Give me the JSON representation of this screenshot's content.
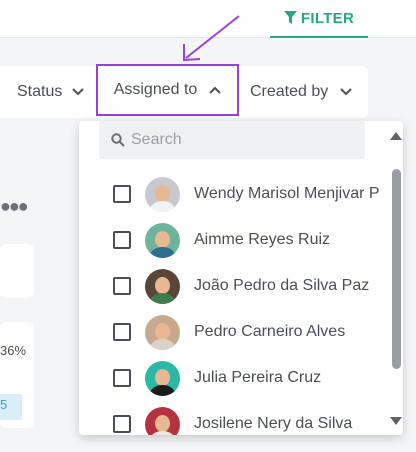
{
  "header": {
    "filter_label": "FILTER",
    "accent_color": "#24a88a"
  },
  "filters": {
    "status_label": "Status",
    "assigned_label": "Assigned to",
    "created_label": "Created by",
    "highlight_color": "#9b3fdc"
  },
  "background": {
    "percent_fragment": "36%",
    "strip_fragment": "5"
  },
  "dropdown": {
    "search_placeholder": "Search",
    "users": [
      {
        "name": "Wendy Marisol Menjivar P",
        "avatar_bg": "#c7c9d1",
        "shirt": "#f3f3f3",
        "checked": false
      },
      {
        "name": "Aimme Reyes Ruiz",
        "avatar_bg": "#6fb39d",
        "shirt": "#2e6f8e",
        "checked": false
      },
      {
        "name": "João Pedro da Silva Paz",
        "avatar_bg": "#5a4636",
        "shirt": "#3b7c4a",
        "checked": false
      },
      {
        "name": "Pedro Carneiro Alves",
        "avatar_bg": "#c9a98e",
        "shirt": "#d8d2c8",
        "checked": false
      },
      {
        "name": "Julia Pereira Cruz",
        "avatar_bg": "#2bb8a6",
        "shirt": "#1b1b1b",
        "checked": false
      },
      {
        "name": "Josilene Nery da Silva",
        "avatar_bg": "#b5323f",
        "shirt": "#f0e6dc",
        "checked": false
      }
    ]
  }
}
